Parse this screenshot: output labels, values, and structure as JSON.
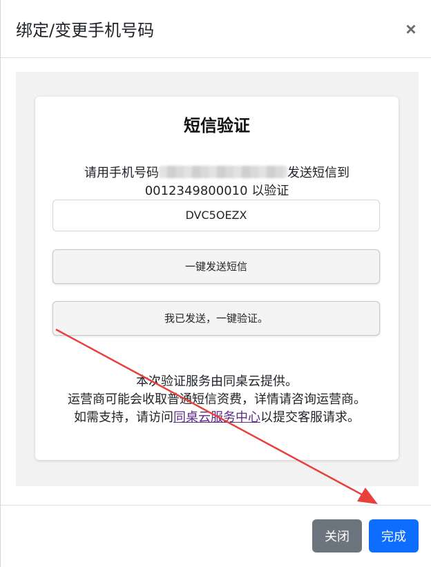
{
  "modal": {
    "title": "绑定/变更手机号码",
    "close_symbol": "×"
  },
  "card": {
    "title": "短信验证",
    "instruction_prefix": "请用手机号码",
    "instruction_suffix": "发送短信到",
    "target_number": "0012349800010",
    "instruction_tail": "以验证",
    "code": "DVC5OEZX",
    "send_button_label": "一键发送短信",
    "verify_button_label": "我已发送，一键验证。",
    "note_line1": "本次验证服务由同桌云提供。",
    "note_line2": "运营商可能会收取普通短信资费，详情请咨询运营商。",
    "note_line3_prefix": "如需支持，请访问",
    "support_link": "同桌云服务中心",
    "note_line3_suffix": "以提交客服请求。"
  },
  "footer": {
    "close_label": "关闭",
    "done_label": "完成"
  },
  "colors": {
    "primary": "#0d6efd",
    "secondary": "#6c757d",
    "annotation_arrow": "#e8403a",
    "link": "#5b2a86"
  }
}
